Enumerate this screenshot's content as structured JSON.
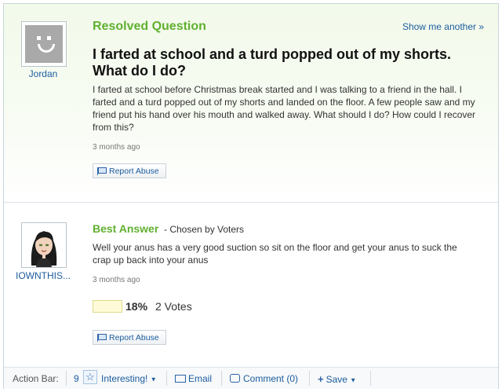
{
  "question": {
    "section_title": "Resolved Question",
    "show_another": "Show me another »",
    "user": "Jordan",
    "title": "I farted at school and a turd popped out of my shorts. What do I do?",
    "body": "I farted at school before Christmas break started and I was talking to a friend in the hall. I farted and a turd popped out of my shorts and landed on the floor. A few people saw and my friend put his hand over his mouth and walked away. What should I do? How could I recover from this?",
    "time": "3 months ago",
    "report": "Report Abuse"
  },
  "answer": {
    "section_title": "Best Answer",
    "chosen_by": "- Chosen by Voters",
    "user": "IOWNTHIS...",
    "body": "Well your anus has a very good suction so sit on the floor and get your anus to suck the crap up back into your anus",
    "time": "3 months ago",
    "vote_percent": "18%",
    "vote_fraction": 0.18,
    "votes": "2 Votes",
    "report": "Report Abuse"
  },
  "action_bar": {
    "label": "Action Bar:",
    "interesting_count": "9",
    "interesting": "Interesting!",
    "email": "Email",
    "comment": "Comment (0)",
    "save": "Save"
  },
  "colors": {
    "accent_green": "#61b030",
    "link_blue": "#1b5c9e"
  },
  "icons": {
    "question_avatar": "smiley-avatar-icon",
    "answer_avatar": "user-avatar-image",
    "report": "flag-icon",
    "interesting": "star-icon",
    "email": "envelope-icon",
    "comment": "comment-bubble-icon",
    "save": "plus-icon"
  }
}
